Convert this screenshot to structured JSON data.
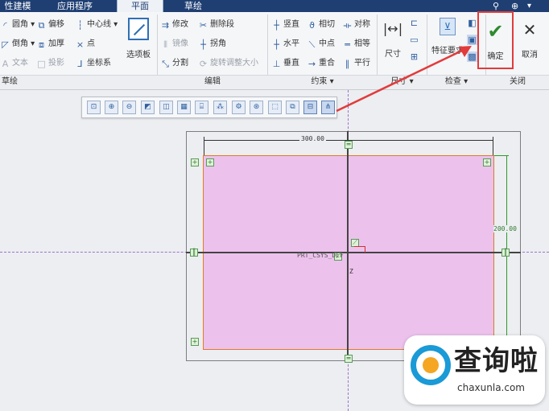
{
  "tabs": [
    "性建模",
    "应用程序",
    "平面",
    "草绘"
  ],
  "ribbon": {
    "groups": [
      "草绘",
      "编辑",
      "约束",
      "尺寸",
      "检查",
      "关闭"
    ],
    "sketch_col1": [
      "圆角 ▾",
      "倒角 ▾",
      "文本"
    ],
    "sketch_col2": [
      "偏移",
      "加厚",
      "投影"
    ],
    "sketch_col3": [
      "中心线 ▾",
      "点",
      "坐标系"
    ],
    "palette_label": "选项板",
    "edit_col1": [
      "修改",
      "镜像",
      "分割"
    ],
    "edit_col2": [
      "删除段",
      "拐角",
      "旋转调整大小"
    ],
    "constraints_col1": [
      "竖直",
      "水平",
      "垂直"
    ],
    "constraints_col2": [
      "相切",
      "中点",
      "重合"
    ],
    "constraints_col3": [
      "对称",
      "相等",
      "平行"
    ],
    "dimension_label": "尺寸",
    "feature_label": "特征要求",
    "ok_label": "确定",
    "cancel_label": "取消"
  },
  "sketch": {
    "width_dim": "300.00",
    "height_dim": "200.00",
    "csys_label": "PRT_CSYS_DEF",
    "axis_label": "Z"
  },
  "watermark": {
    "text": "查询啦",
    "url": "chaxunla.com"
  },
  "colors": {
    "title_bar": "#1f3f73",
    "sketch_fill": "#ecc2ec",
    "highlight": "#e23b3b",
    "ok_green": "#2e8a2e"
  }
}
